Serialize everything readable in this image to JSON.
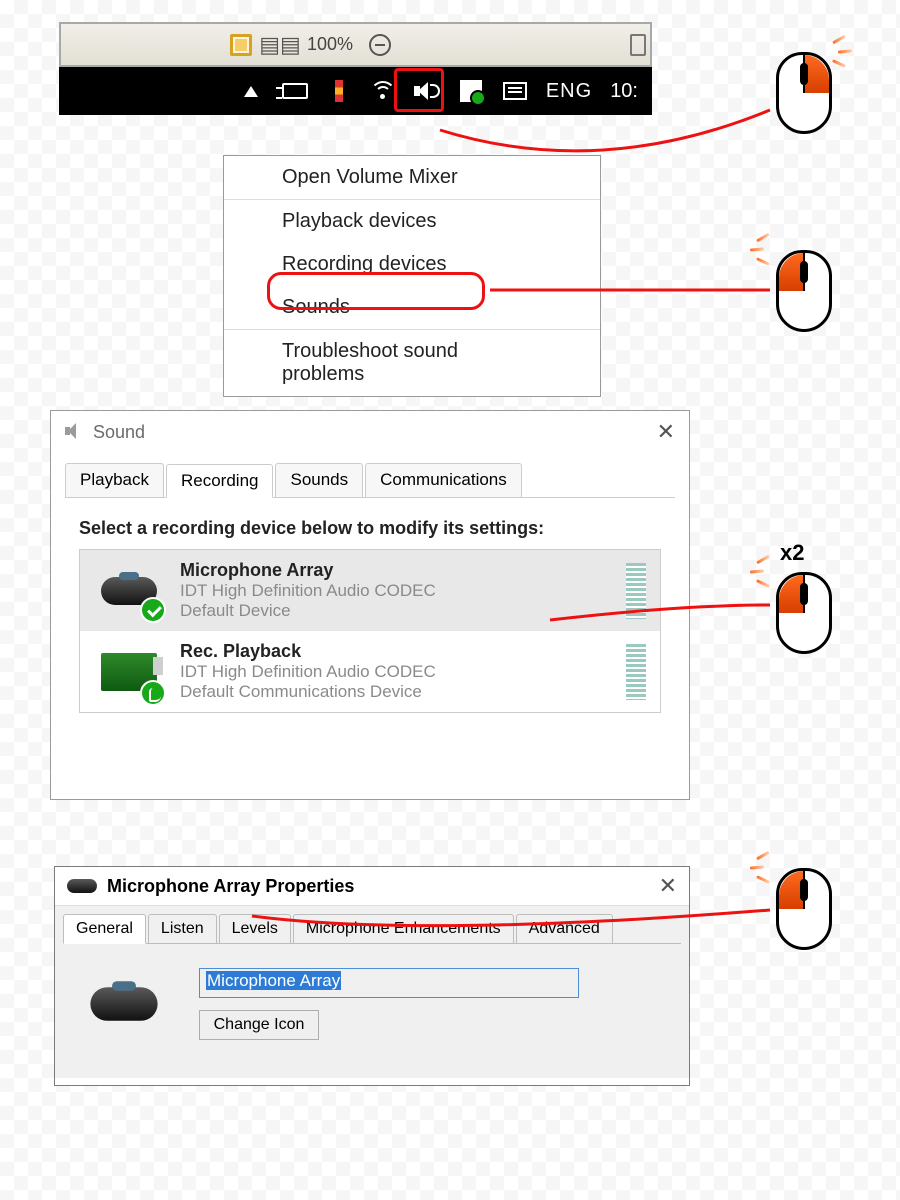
{
  "toolbar": {
    "zoom_label": "100%"
  },
  "tray": {
    "language": "ENG",
    "time": "10:"
  },
  "context_menu": {
    "items": [
      "Open Volume Mixer",
      "Playback devices",
      "Recording devices",
      "Sounds",
      "Troubleshoot sound problems"
    ]
  },
  "sound_dialog": {
    "title": "Sound",
    "tabs": [
      "Playback",
      "Recording",
      "Sounds",
      "Communications"
    ],
    "active_tab": 1,
    "instruction": "Select a recording device below to modify its settings:",
    "devices": [
      {
        "name": "Microphone Array",
        "desc": "IDT High Definition Audio CODEC",
        "status": "Default Device"
      },
      {
        "name": "Rec. Playback",
        "desc": "IDT High Definition Audio CODEC",
        "status": "Default Communications Device"
      }
    ]
  },
  "properties_dialog": {
    "title": "Microphone Array Properties",
    "tabs": [
      "General",
      "Listen",
      "Levels",
      "Microphone Enhancements",
      "Advanced"
    ],
    "active_tab": 0,
    "name_value": "Microphone Array",
    "change_icon_label": "Change Icon"
  },
  "annotations": {
    "x2": "x2"
  }
}
